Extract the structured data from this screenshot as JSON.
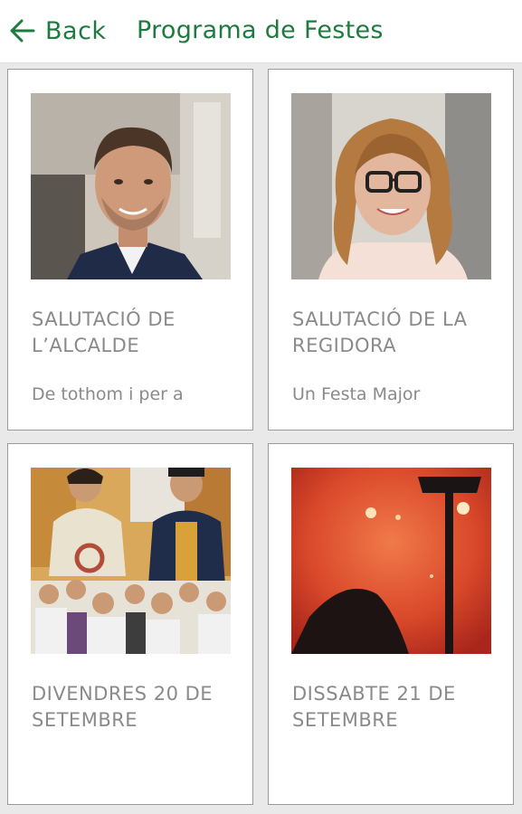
{
  "header": {
    "back_label": "Back",
    "title": "Programa de Festes"
  },
  "cards": [
    {
      "title": "SALUTACIÓ DE L’ALCALDE",
      "excerpt": "De tothom i per a",
      "image": "portrait-man-suit"
    },
    {
      "title": "SALUTACIÓ DE LA REGIDORA",
      "excerpt": "Un Festa Major",
      "image": "portrait-woman-glasses"
    },
    {
      "title": "DIVENDRES 20 DE SETEMBRE",
      "excerpt": "",
      "image": "giants-parade-crowd"
    },
    {
      "title": "DISSABTE 21 DE SETEMBRE",
      "excerpt": "",
      "image": "fireworks-red-night"
    }
  ],
  "colors": {
    "accent": "#1e7a3f",
    "card_text": "#8a8a8a",
    "grid_bg": "#e9e9e9"
  }
}
